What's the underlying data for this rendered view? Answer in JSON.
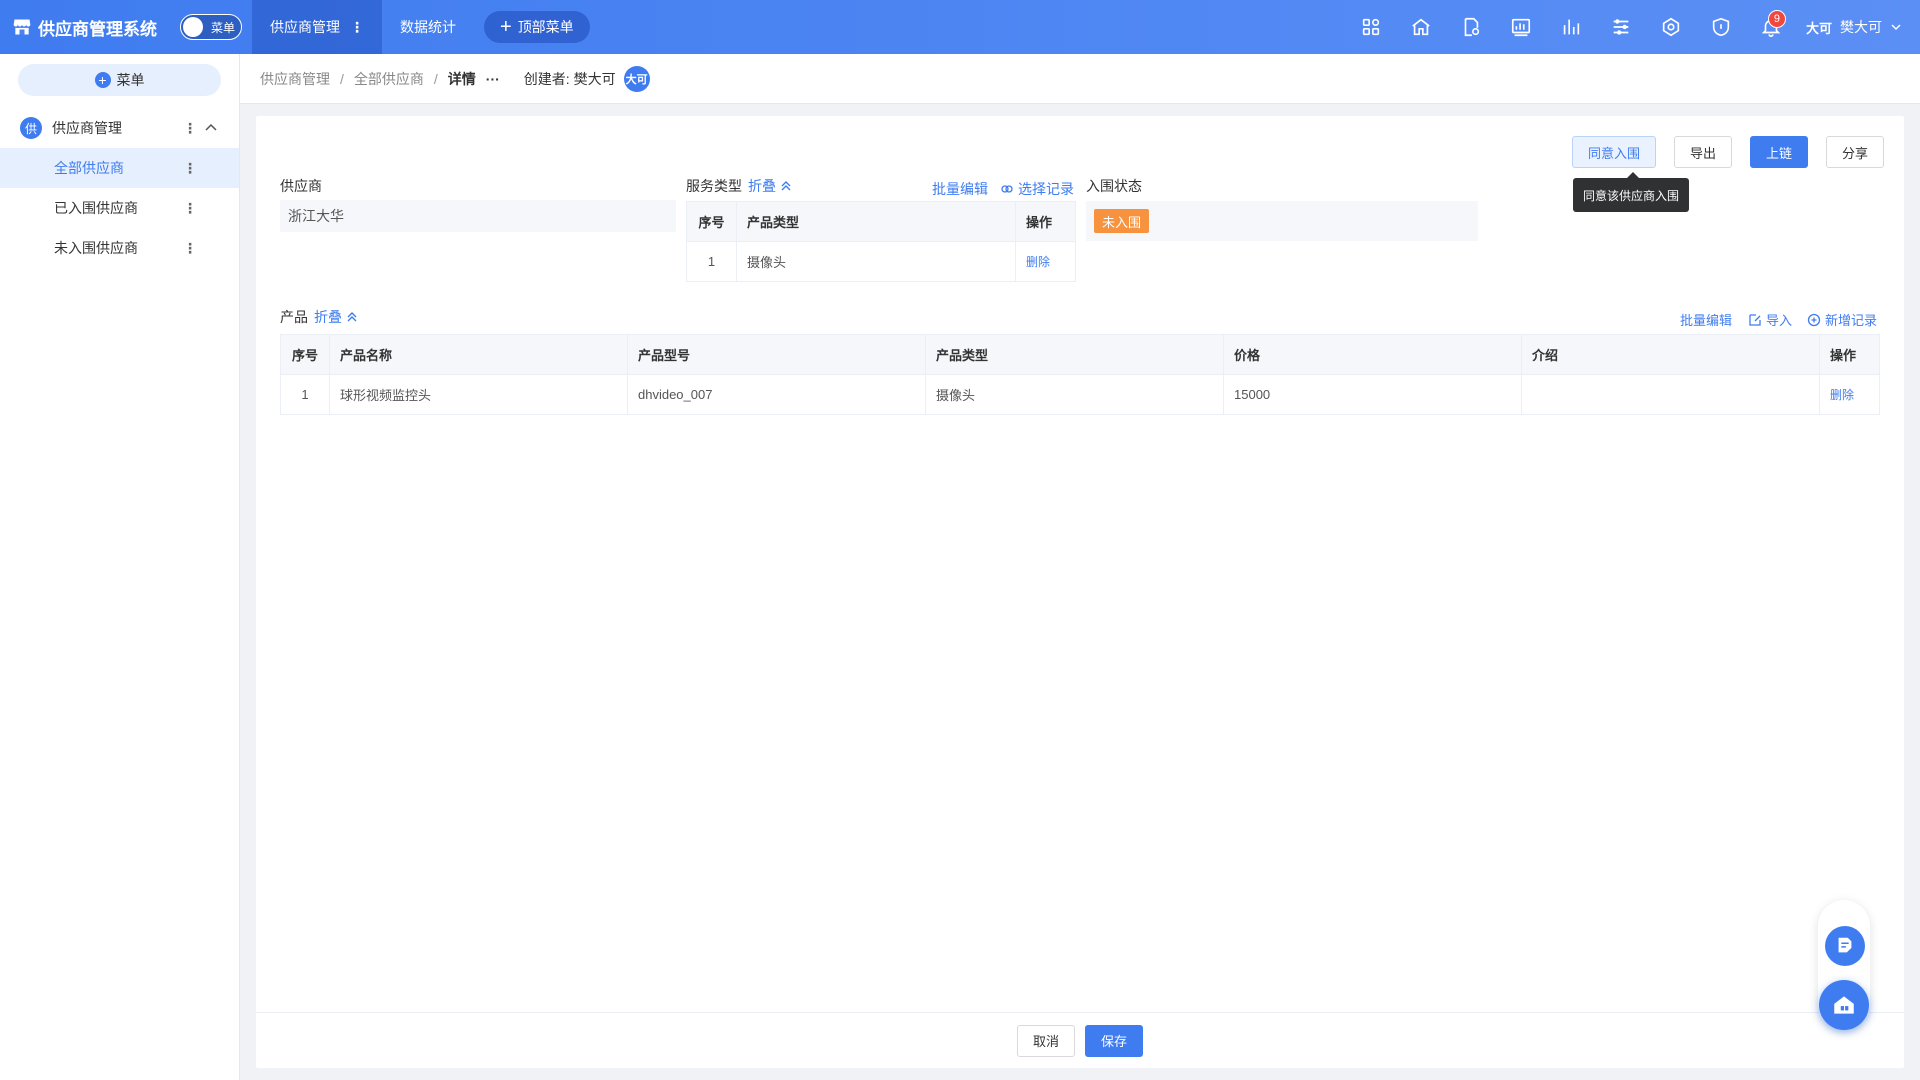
{
  "app": {
    "title": "供应商管理系统",
    "menu_toggle_label": "菜单"
  },
  "top_nav": {
    "items": [
      {
        "label": "供应商管理",
        "more": "⋮"
      },
      {
        "label": "数据统计"
      }
    ],
    "top_menu_label": "顶部菜单",
    "notification_count": "9",
    "user_avatar_text": "大可",
    "user_name": "樊大可"
  },
  "sidebar": {
    "menu_button": "菜单",
    "group": {
      "icon_text": "供",
      "label": "供应商管理"
    },
    "items": [
      {
        "label": "全部供应商",
        "active": true
      },
      {
        "label": "已入围供应商"
      },
      {
        "label": "未入围供应商"
      }
    ],
    "dots": "⋮"
  },
  "breadcrumb": {
    "items": [
      "供应商管理",
      "全部供应商",
      "详情"
    ],
    "separator": "/",
    "more": "···",
    "creator_label": "创建者:",
    "creator_name": "樊大可",
    "creator_avatar": "大可"
  },
  "actions": {
    "approve": "同意入围",
    "export": "导出",
    "chain": "上链",
    "share": "分享",
    "approve_tooltip": "同意该供应商入围"
  },
  "form": {
    "supplier_label": "供应商",
    "supplier_value": "浙江大华",
    "service_type_label": "服务类型",
    "collapse_label": "折叠",
    "batch_edit": "批量编辑",
    "select_record": "选择记录",
    "status_label": "入围状态",
    "status_value": "未入围"
  },
  "service_table": {
    "headers": [
      "序号",
      "产品类型",
      "操作"
    ],
    "rows": [
      {
        "idx": "1",
        "type": "摄像头",
        "op": "删除"
      }
    ]
  },
  "products": {
    "label": "产品",
    "collapse_label": "折叠",
    "batch_edit": "批量编辑",
    "import": "导入",
    "add_record": "新增记录",
    "headers": [
      "序号",
      "产品名称",
      "产品型号",
      "产品类型",
      "价格",
      "介绍",
      "操作"
    ],
    "rows": [
      {
        "idx": "1",
        "name": "球形视频监控头",
        "model": "dhvideo_007",
        "type": "摄像头",
        "price": "15000",
        "intro": "",
        "op": "删除"
      }
    ]
  },
  "footer": {
    "cancel": "取消",
    "save": "保存"
  },
  "colors": {
    "primary": "#3f7cf0",
    "status_tag": "#f7933e",
    "badge": "#f0483e"
  }
}
